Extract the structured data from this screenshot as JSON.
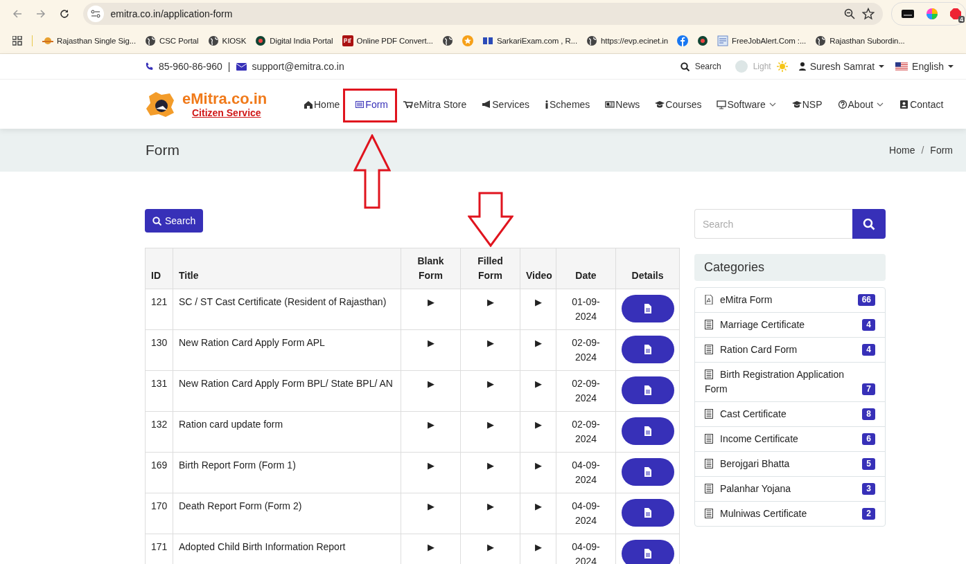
{
  "browser": {
    "url": "emitra.co.in/application-form",
    "bookmarks": [
      {
        "kind": "logo",
        "label": "Rajasthan Single Sig..."
      },
      {
        "kind": "globe",
        "label": "CSC Portal"
      },
      {
        "kind": "globe",
        "label": "KIOSK"
      },
      {
        "kind": "dot",
        "label": "Digital India Portal"
      },
      {
        "kind": "pdf",
        "label": "Online PDF Convert..."
      },
      {
        "kind": "globe"
      },
      {
        "kind": "star"
      },
      {
        "kind": "se",
        "label": "SarkariExam.com , R..."
      },
      {
        "kind": "globe",
        "label": "https://evp.ecinet.in"
      },
      {
        "kind": "facebook"
      },
      {
        "kind": "dot"
      },
      {
        "kind": "doc",
        "label": "FreeJobAlert.Com :..."
      },
      {
        "kind": "globe",
        "label": "Rajasthan Subordin..."
      }
    ],
    "extension_badge": "4"
  },
  "topbar": {
    "phone": "85-960-86-960",
    "separator": "|",
    "email": "support@emitra.co.in",
    "search": "Search",
    "theme": "Light",
    "user": "Suresh Samrat",
    "language": "English"
  },
  "header": {
    "logo_title": "eMitra.co.in",
    "logo_subtitle": "Citizen Service",
    "nav": [
      {
        "kind": "home",
        "label": "Home",
        "selected": false,
        "dropdown": false
      },
      {
        "kind": "form",
        "label": "Form",
        "selected": true,
        "dropdown": false
      },
      {
        "kind": "cart",
        "label": "eMitra Store",
        "selected": false,
        "dropdown": false
      },
      {
        "kind": "megaphone",
        "label": "Services",
        "selected": false,
        "dropdown": false
      },
      {
        "kind": "info",
        "label": "Schemes",
        "selected": false,
        "dropdown": false
      },
      {
        "kind": "news",
        "label": "News",
        "selected": false,
        "dropdown": false
      },
      {
        "kind": "cap",
        "label": "Courses",
        "selected": false,
        "dropdown": false
      },
      {
        "kind": "monitor",
        "label": "Software",
        "selected": false,
        "dropdown": true
      },
      {
        "kind": "cap",
        "label": "NSP",
        "selected": false,
        "dropdown": false
      },
      {
        "kind": "question",
        "label": "About",
        "selected": false,
        "dropdown": true
      },
      {
        "kind": "contact",
        "label": "Contact",
        "selected": false,
        "dropdown": false
      }
    ]
  },
  "page": {
    "title": "Form",
    "breadcrumb": [
      "Home",
      "Form"
    ],
    "breadcrumb_separator": "/"
  },
  "search_button": "Search",
  "table": {
    "columns": [
      "ID",
      "Title",
      "Blank Form",
      "Filled Form",
      "Video",
      "Date",
      "Details"
    ],
    "rows": [
      {
        "id": "121",
        "title": "SC / ST Cast Certificate (Resident of Rajasthan)",
        "blank": "▶",
        "filled": "▶",
        "video": "▶",
        "date": "01-09-2024"
      },
      {
        "id": "130",
        "title": "New Ration Card Apply Form APL",
        "blank": "▶",
        "filled": "▶",
        "video": "▶",
        "date": "02-09-2024"
      },
      {
        "id": "131",
        "title": "New Ration Card Apply Form BPL/ State BPL/ AN",
        "blank": "▶",
        "filled": "▶",
        "video": "▶",
        "date": "02-09-2024"
      },
      {
        "id": "132",
        "title": "Ration card update form",
        "blank": "▶",
        "filled": "▶",
        "video": "▶",
        "date": "02-09-2024"
      },
      {
        "id": "169",
        "title": "Birth Report Form (Form 1)",
        "blank": "▶",
        "filled": "▶",
        "video": "▶",
        "date": "04-09-2024"
      },
      {
        "id": "170",
        "title": "Death Report Form (Form 2)",
        "blank": "▶",
        "filled": "▶",
        "video": "▶",
        "date": "04-09-2024"
      },
      {
        "id": "171",
        "title": "Adopted Child Birth Information Report",
        "blank": "▶",
        "filled": "▶",
        "video": "▶",
        "date": "04-09-2024"
      }
    ]
  },
  "sidebar": {
    "search_placeholder": "Search",
    "categories_title": "Categories",
    "categories": [
      {
        "kind": "pdf",
        "label": "eMitra Form",
        "count": "66"
      },
      {
        "kind": "list",
        "label": "Marriage Certificate",
        "count": "4"
      },
      {
        "kind": "list",
        "label": "Ration Card Form",
        "count": "4"
      },
      {
        "kind": "list",
        "label": "Birth Registration Application Form",
        "count": "7"
      },
      {
        "kind": "list",
        "label": "Cast Certificate",
        "count": "8"
      },
      {
        "kind": "list",
        "label": "Income Certificate",
        "count": "6"
      },
      {
        "kind": "list",
        "label": "Berojgari Bhatta",
        "count": "5"
      },
      {
        "kind": "list",
        "label": "Palanhar Yojana",
        "count": "3"
      },
      {
        "kind": "list",
        "label": "Mulniwas Certificate",
        "count": "2"
      }
    ]
  },
  "annotations": [
    {
      "kind": "box"
    },
    {
      "kind": "arrow-up"
    },
    {
      "kind": "arrow-down"
    }
  ]
}
